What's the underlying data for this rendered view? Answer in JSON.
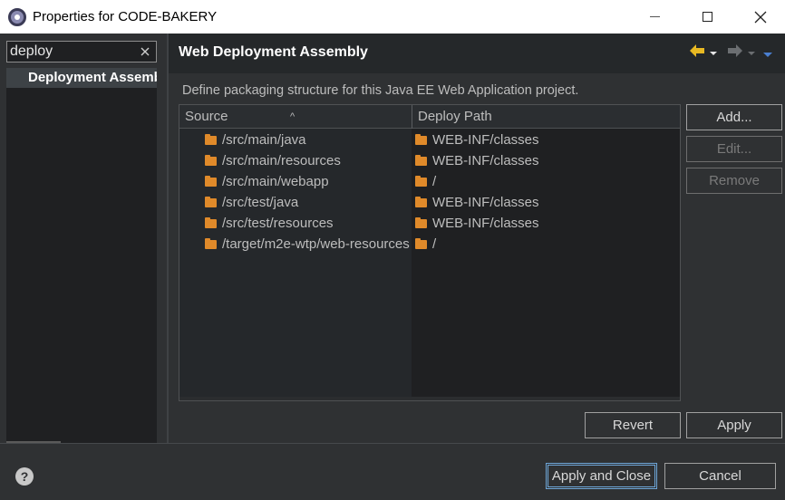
{
  "window": {
    "title": "Properties for CODE-BAKERY",
    "minimize_icon": "minimize-icon",
    "maximize_icon": "maximize-icon",
    "close_icon": "close-icon"
  },
  "filter": {
    "value": "deploy",
    "clear_icon": "clear-icon"
  },
  "tree": {
    "items": [
      {
        "label": "Deployment Assembly",
        "selected": true
      }
    ]
  },
  "page": {
    "title": "Web Deployment Assembly",
    "description": "Define packaging structure for this Java EE Web Application project.",
    "nav": {
      "back_icon": "arrow-left-icon",
      "back_menu_icon": "chevron-down-icon",
      "forward_icon": "arrow-right-icon",
      "forward_menu_icon": "chevron-down-icon",
      "view_menu_icon": "view-menu-icon"
    }
  },
  "table": {
    "columns": [
      "Source",
      "Deploy Path"
    ],
    "rows": [
      {
        "source": "/src/main/java",
        "deploy_path": "WEB-INF/classes"
      },
      {
        "source": "/src/main/resources",
        "deploy_path": "WEB-INF/classes"
      },
      {
        "source": "/src/main/webapp",
        "deploy_path": "/"
      },
      {
        "source": "/src/test/java",
        "deploy_path": "WEB-INF/classes"
      },
      {
        "source": "/src/test/resources",
        "deploy_path": "WEB-INF/classes"
      },
      {
        "source": "/target/m2e-wtp/web-resources",
        "deploy_path": "/"
      }
    ]
  },
  "buttons": {
    "add": "Add...",
    "edit": "Edit...",
    "remove": "Remove",
    "revert": "Revert",
    "apply": "Apply",
    "apply_and_close": "Apply and Close",
    "cancel": "Cancel"
  },
  "colors": {
    "background": "#2f3133",
    "folder": "#e08a2a",
    "nav_back": "#e8b923",
    "view_menu": "#4a7fd0"
  }
}
